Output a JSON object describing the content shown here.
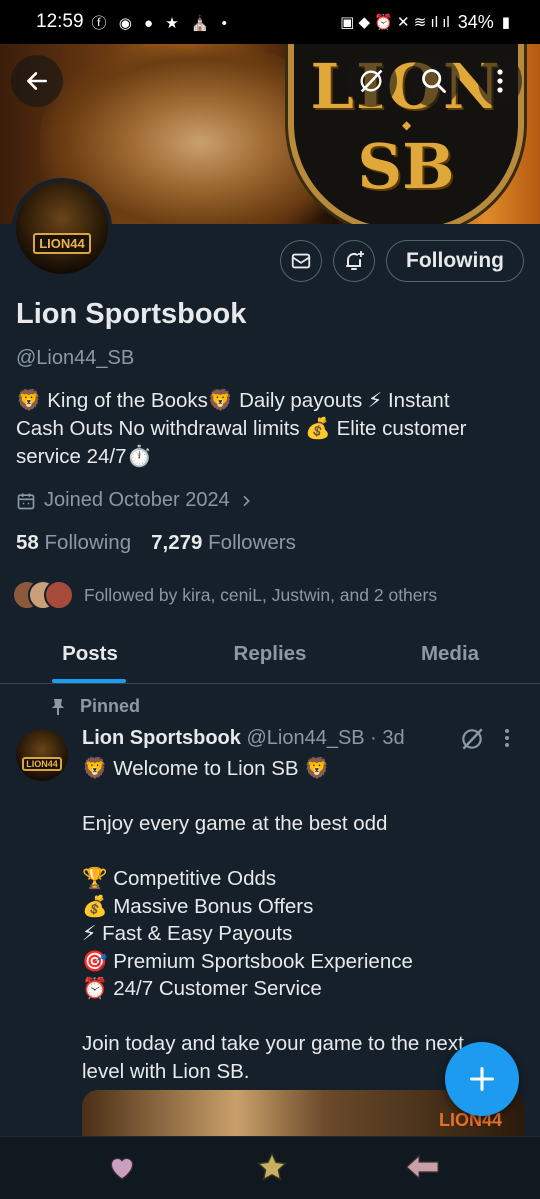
{
  "status_bar": {
    "time": "12:59",
    "battery": "34%"
  },
  "banner": {
    "logo_line1": "LION",
    "logo_line2": "SB"
  },
  "avatar": {
    "badge": "LION44"
  },
  "actions": {
    "following_label": "Following"
  },
  "profile": {
    "name": "Lion Sportsbook",
    "handle": "@Lion44_SB",
    "bio_line1": "🦁 King of the Books🦁 Daily payouts ⚡ Instant",
    "bio_line2": "Cash Outs No withdrawal limits 💰 Elite customer",
    "bio_line3": "service 24/7⏱️",
    "joined": "Joined October 2024",
    "following_count": "58",
    "following_label": "Following",
    "followers_count": "7,279",
    "followers_label": "Followers",
    "followed_by": "Followed by kira, ceniL, Justwin, and 2 others"
  },
  "tabs": [
    {
      "label": "Posts"
    },
    {
      "label": "Replies"
    },
    {
      "label": "Media"
    }
  ],
  "post": {
    "pinned_label": "Pinned",
    "author": "Lion Sportsbook",
    "handle_time": "@Lion44_SB · 3d",
    "lines": [
      "🦁 Welcome to Lion SB 🦁",
      "",
      "Enjoy every game at the best odd",
      "",
      "🏆 Competitive Odds",
      "💰 Massive Bonus Offers",
      "⚡ Fast & Easy Payouts",
      "🎯 Premium Sportsbook Experience",
      "⏰ 24/7 Customer Service",
      "",
      "Join today and take your game to the next",
      "level with Lion SB."
    ],
    "media_label": "LION44"
  },
  "colors": {
    "background": "#15202b",
    "accent": "#1d9bf0",
    "muted": "#8b98a5"
  }
}
